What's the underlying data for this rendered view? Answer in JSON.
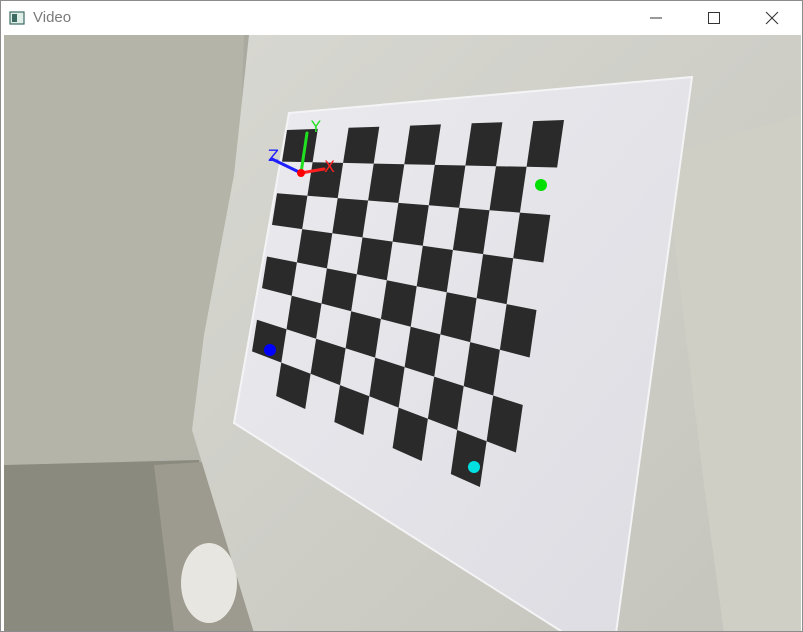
{
  "window": {
    "title": "Video",
    "controls": {
      "minimize": "minimize-icon",
      "maximize": "maximize-icon",
      "close": "close-icon"
    }
  },
  "overlay": {
    "axis_labels": {
      "x": "X",
      "y": "Y",
      "z": "Z"
    },
    "axis_colors": {
      "x": "#ff2020",
      "y": "#20e020",
      "z": "#2020ff",
      "origin": "#ff0000"
    },
    "corner_markers": {
      "top_right": "#00e000",
      "left": "#0000ff",
      "bottom": "#00e0e0"
    }
  },
  "scene": {
    "board_paper_color": "#e6e6ea",
    "square_color": "#2a2a2a",
    "wall_color": "#b8b8b0",
    "counter_color": "#cfcfc8"
  }
}
